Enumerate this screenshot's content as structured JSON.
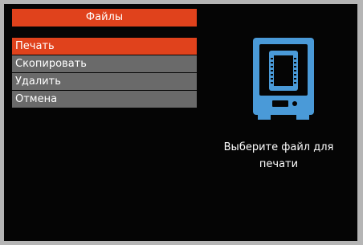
{
  "panel": {
    "title": "Файлы"
  },
  "menu": {
    "items": [
      {
        "label": "Печать"
      },
      {
        "label": "Скопировать"
      },
      {
        "label": "Удалить"
      },
      {
        "label": "Отмена"
      }
    ],
    "selected_index": 0
  },
  "icon": {
    "name": "printer-file-icon",
    "color": "#4a9ad8"
  },
  "prompt": {
    "line1": "Выберите файл для",
    "line2": "печати"
  },
  "colors": {
    "accent": "#e0421c",
    "menu_item_bg": "#6a6a6a",
    "screen_bg": "#050505",
    "text": "#ffffff"
  }
}
